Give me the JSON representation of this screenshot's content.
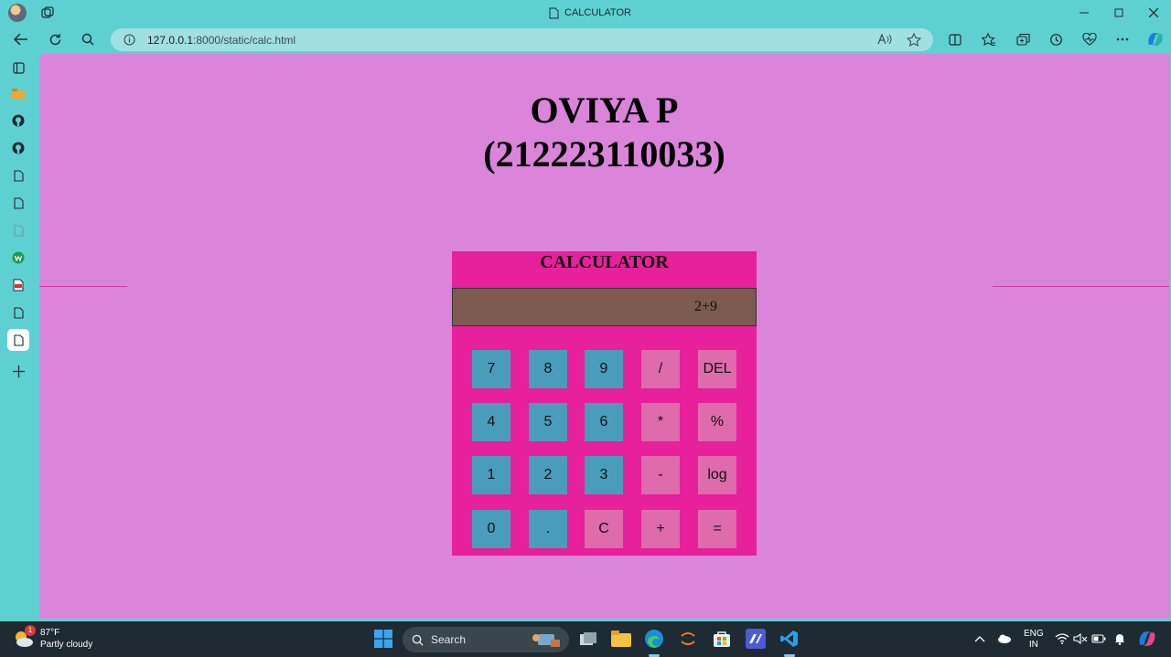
{
  "browser": {
    "tab_title": "CALCULATOR",
    "url_host": "127.0.0.1",
    "url_rest": ":8000/static/calc.html"
  },
  "page": {
    "heading_line1": "OVIYA P",
    "heading_line2": "(212223110033)"
  },
  "calculator": {
    "title": "CALCULATOR",
    "display": "2+9",
    "keys": [
      [
        "7",
        "8",
        "9",
        "/",
        "DEL"
      ],
      [
        "4",
        "5",
        "6",
        "*",
        "%"
      ],
      [
        "1",
        "2",
        "3",
        "-",
        "log"
      ],
      [
        "0",
        ".",
        "C",
        "+",
        "="
      ]
    ]
  },
  "taskbar": {
    "temperature": "87°F",
    "weather": "Partly cloudy",
    "weather_badge": "1",
    "search_label": "Search",
    "lang_line1": "ENG",
    "lang_line2": "IN"
  },
  "colors": {
    "page_bg": "#da84da",
    "calc_bg": "#e7209b",
    "display_bg": "#7d5a4f",
    "num_key": "#4a9cbb",
    "op_key": "#de6bab",
    "chrome": "#5fd0d2"
  }
}
